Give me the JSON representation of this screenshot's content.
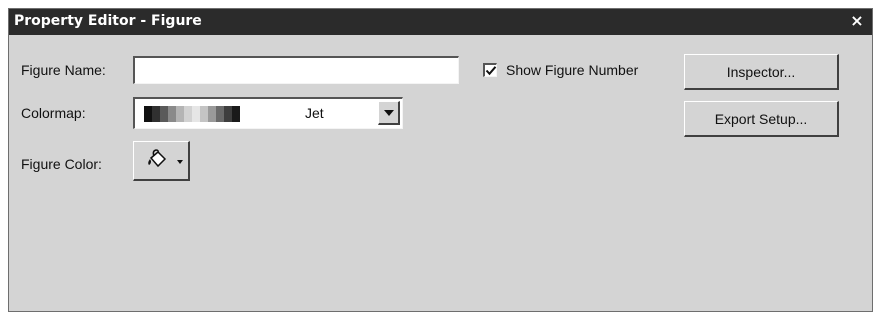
{
  "window": {
    "title": "Property Editor - Figure",
    "close_glyph": "×"
  },
  "form": {
    "figure_name_label": "Figure Name:",
    "figure_name_value": "",
    "show_figure_number_label": "Show Figure Number",
    "show_figure_number_checked": true,
    "colormap_label": "Colormap:",
    "colormap_value": "Jet",
    "colormap_swatch_colors": [
      "#111111",
      "#303030",
      "#5a5a5a",
      "#8a8a8a",
      "#b4b4b4",
      "#d2d2d2",
      "#e6e6e6",
      "#c4c4c4",
      "#9a9a9a",
      "#6a6a6a",
      "#3e3e3e",
      "#1a1a1a"
    ],
    "figure_color_label": "Figure Color:",
    "figure_color_icon": "paint-bucket-icon"
  },
  "buttons": {
    "inspector_label": "Inspector...",
    "export_setup_label": "Export Setup..."
  }
}
